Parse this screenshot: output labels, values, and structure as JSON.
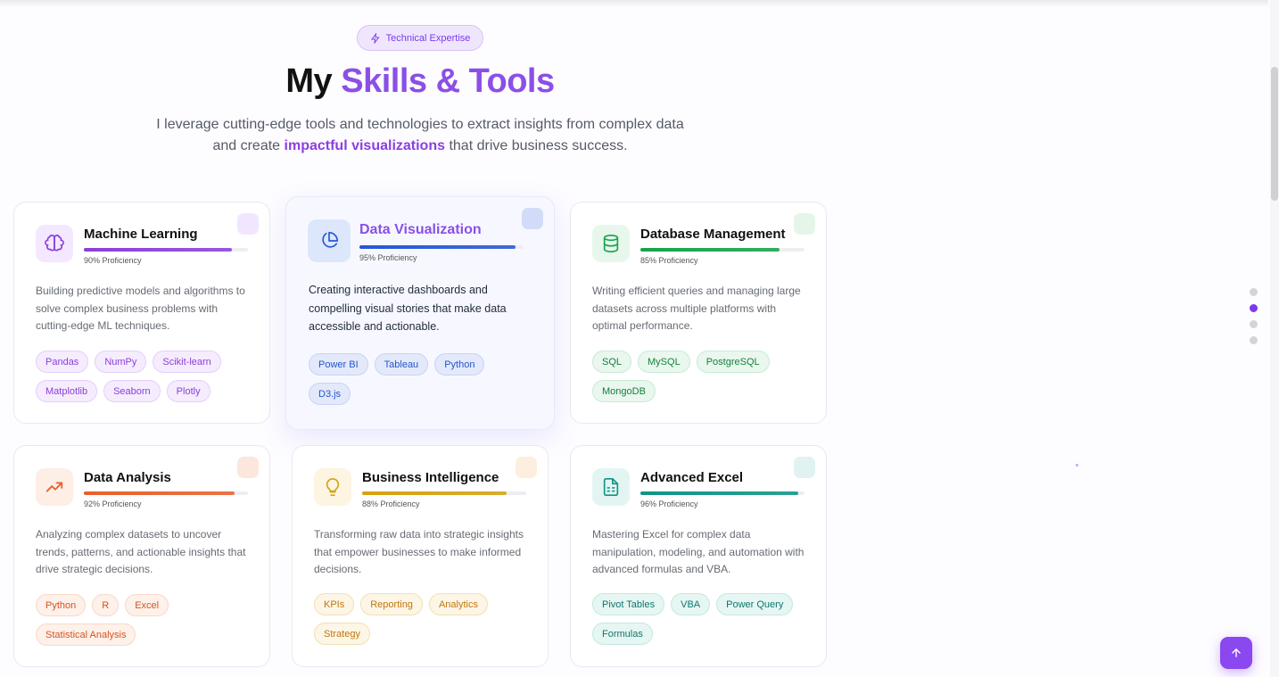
{
  "badge": {
    "label": "Technical Expertise",
    "icon": "sparkle-icon"
  },
  "header": {
    "title_plain": "My",
    "title_accent": "Skills & Tools",
    "subtitle_part1": "I leverage cutting-edge tools and technologies to extract insights from complex data and create",
    "subtitle_highlight": "impactful visualizations",
    "subtitle_part2": "that drive business success."
  },
  "cards": [
    {
      "title": "Machine Learning",
      "icon": "brain-icon",
      "proficiency": 0.9,
      "proficiency_label": "90% Proficiency",
      "description": "Building predictive models and algorithms to solve complex business problems with cutting-edge ML techniques.",
      "tags": [
        "Pandas",
        "NumPy",
        "Scikit-learn",
        "Matplotlib",
        "Seaborn",
        "Plotly"
      ],
      "colors": {
        "accent": "#8b3fd9",
        "tint": "#f3e8ff",
        "tag_bg": "#f5ecfe",
        "tag_border": "#e4cffb",
        "tag_text": "#8b3fd9",
        "corner": "#f1e6fd"
      }
    },
    {
      "title": "Data Visualization",
      "icon": "pie-chart-icon",
      "proficiency": 0.95,
      "proficiency_label": "95% Proficiency",
      "description": "Creating interactive dashboards and compelling visual stories that make data accessible and actionable.",
      "tags": [
        "Power BI",
        "Tableau",
        "Python",
        "D3.js"
      ],
      "colors": {
        "accent": "#2456d6",
        "tint": "#dde7fb",
        "tag_bg": "#e3e9fb",
        "tag_border": "#c7d4f4",
        "tag_text": "#2456c9",
        "corner": "#d2dcf8"
      }
    },
    {
      "title": "Database Management",
      "icon": "database-icon",
      "proficiency": 0.85,
      "proficiency_label": "85% Proficiency",
      "description": "Writing efficient queries and managing large datasets across multiple platforms with optimal performance.",
      "tags": [
        "SQL",
        "MySQL",
        "PostgreSQL",
        "MongoDB"
      ],
      "colors": {
        "accent": "#16a34a",
        "tint": "#e7f7ec",
        "tag_bg": "#e9f7ee",
        "tag_border": "#c8ebd4",
        "tag_text": "#15803d",
        "corner": "#e6f5ea"
      }
    },
    {
      "title": "Data Analysis",
      "icon": "trending-up-icon",
      "proficiency": 0.92,
      "proficiency_label": "92% Proficiency",
      "description": "Analyzing complex datasets to uncover trends, patterns, and actionable insights that drive strategic decisions.",
      "tags": [
        "Python",
        "R",
        "Excel",
        "Statistical Analysis"
      ],
      "colors": {
        "accent": "#e8612c",
        "tint": "#fdeee6",
        "tag_bg": "#fdf1ea",
        "tag_border": "#f8d9c7",
        "tag_text": "#d9531f",
        "corner": "#fce7dc"
      }
    },
    {
      "title": "Business Intelligence",
      "icon": "lightbulb-icon",
      "proficiency": 0.88,
      "proficiency_label": "88% Proficiency",
      "description": "Transforming raw data into strategic insights that empower businesses to make informed decisions.",
      "tags": [
        "KPIs",
        "Reporting",
        "Analytics",
        "Strategy"
      ],
      "colors": {
        "accent": "#d6a20f",
        "tint": "#fdf4e1",
        "tag_bg": "#fdf6e6",
        "tag_border": "#f3e0b2",
        "tag_text": "#c2760c",
        "corner": "#fcefe0"
      }
    },
    {
      "title": "Advanced Excel",
      "icon": "spreadsheet-icon",
      "proficiency": 0.96,
      "proficiency_label": "96% Proficiency",
      "description": "Mastering Excel for complex data manipulation, modeling, and automation with advanced formulas and VBA.",
      "tags": [
        "Pivot Tables",
        "VBA",
        "Power Query",
        "Formulas"
      ],
      "colors": {
        "accent": "#0f9488",
        "tint": "#e3f5f2",
        "tag_bg": "#e6f6f3",
        "tag_border": "#c5e8e2",
        "tag_text": "#0f766e",
        "corner": "#e1f3f0"
      }
    }
  ],
  "section_nav": {
    "count": 4,
    "active_index": 1
  },
  "back_to_top": {
    "icon": "arrow-up-icon"
  }
}
